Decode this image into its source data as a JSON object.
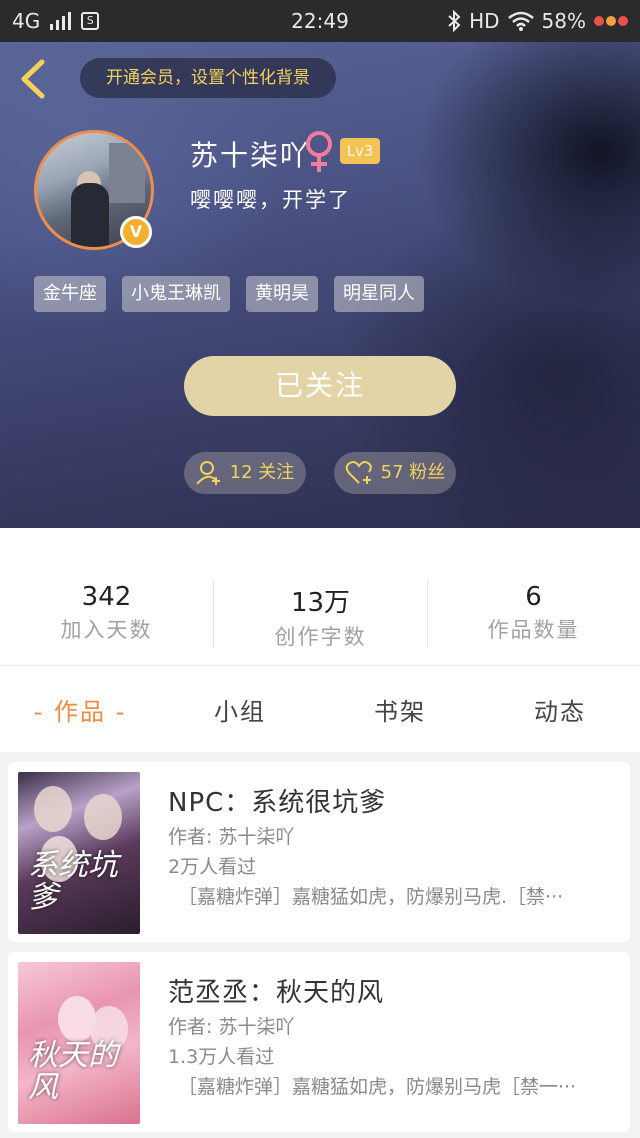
{
  "status_bar": {
    "network": "4G",
    "sim": "S",
    "time": "22:49",
    "hd": "HD",
    "battery": "58%"
  },
  "header": {
    "member_banner": "开通会员，设置个性化背景"
  },
  "profile": {
    "name": "苏十柒吖",
    "gender": "female",
    "level": "Lv3",
    "signature": "嘤嘤嘤，开学了",
    "verified_badge": "V",
    "tags": [
      "金牛座",
      "小鬼王琳凯",
      "黄明昊",
      "明星同人"
    ],
    "follow_button": "已关注",
    "following": "12 关注",
    "fans": "57 粉丝"
  },
  "stats": [
    {
      "value": "342",
      "label": "加入天数"
    },
    {
      "value": "13万",
      "label": "创作字数"
    },
    {
      "value": "6",
      "label": "作品数量"
    }
  ],
  "tabs": [
    {
      "label": "- 作品 -",
      "active": true
    },
    {
      "label": "小组",
      "active": false
    },
    {
      "label": "书架",
      "active": false
    },
    {
      "label": "动态",
      "active": false
    }
  ],
  "books": [
    {
      "title": "NPC：系统很坑爹",
      "author": "作者: 苏十柒吖",
      "views": "2万人看过",
      "tags": "［嘉糖炸弹］嘉糖猛如虎，防爆别马虎.［禁···",
      "cover_text": "系统坑爹"
    },
    {
      "title": "范丞丞：秋天的风",
      "author": "作者: 苏十柒吖",
      "views": "1.3万人看过",
      "tags": "［嘉糖炸弹］嘉糖猛如虎，防爆别马虎［禁一···",
      "cover_text": "秋天的风"
    }
  ],
  "colors": {
    "accent": "#f08a45",
    "gold": "#f3d25b",
    "follow_btn": "#e3d4a8",
    "avatar_ring": "#ee8d4d"
  },
  "icons": [
    "back-arrow-icon",
    "female-icon",
    "verified-icon",
    "add-user-icon",
    "heart-plus-icon",
    "bluetooth-icon",
    "wifi-icon",
    "signal-icon"
  ]
}
